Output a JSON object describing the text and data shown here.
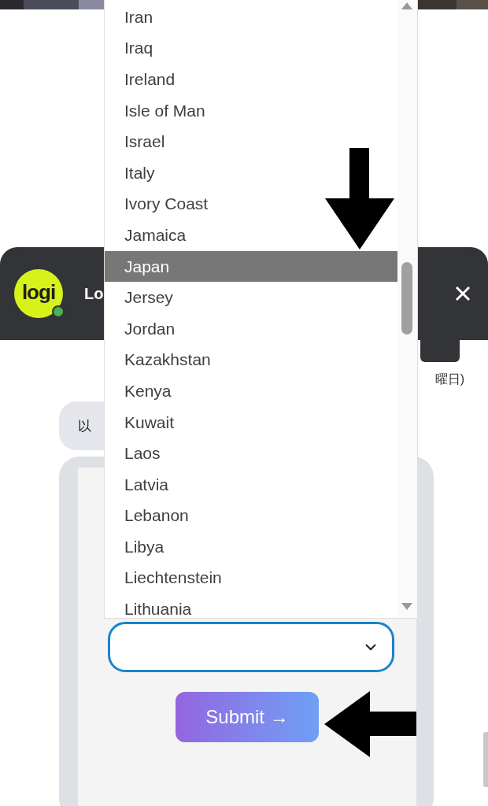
{
  "chat_header": {
    "logo_text": "logi",
    "title": "Lo",
    "online": true
  },
  "date_caption": "曜日)",
  "message": "以",
  "country_select": {
    "open": true
  },
  "submit_button": "Submit →",
  "dropdown": {
    "options": [
      {
        "label": "Iran",
        "selected": false
      },
      {
        "label": "Iraq",
        "selected": false
      },
      {
        "label": "Ireland",
        "selected": false
      },
      {
        "label": "Isle of Man",
        "selected": false
      },
      {
        "label": "Israel",
        "selected": false
      },
      {
        "label": "Italy",
        "selected": false
      },
      {
        "label": "Ivory Coast",
        "selected": false
      },
      {
        "label": "Jamaica",
        "selected": false
      },
      {
        "label": "Japan",
        "selected": true
      },
      {
        "label": "Jersey",
        "selected": false
      },
      {
        "label": "Jordan",
        "selected": false
      },
      {
        "label": "Kazakhstan",
        "selected": false
      },
      {
        "label": "Kenya",
        "selected": false
      },
      {
        "label": "Kuwait",
        "selected": false
      },
      {
        "label": "Laos",
        "selected": false
      },
      {
        "label": "Latvia",
        "selected": false
      },
      {
        "label": "Lebanon",
        "selected": false
      },
      {
        "label": "Libya",
        "selected": false
      },
      {
        "label": "Liechtenstein",
        "selected": false
      },
      {
        "label": "Lithuania",
        "selected": false
      }
    ]
  },
  "annotations": [
    {
      "kind": "arrow-down"
    },
    {
      "kind": "arrow-left"
    }
  ]
}
